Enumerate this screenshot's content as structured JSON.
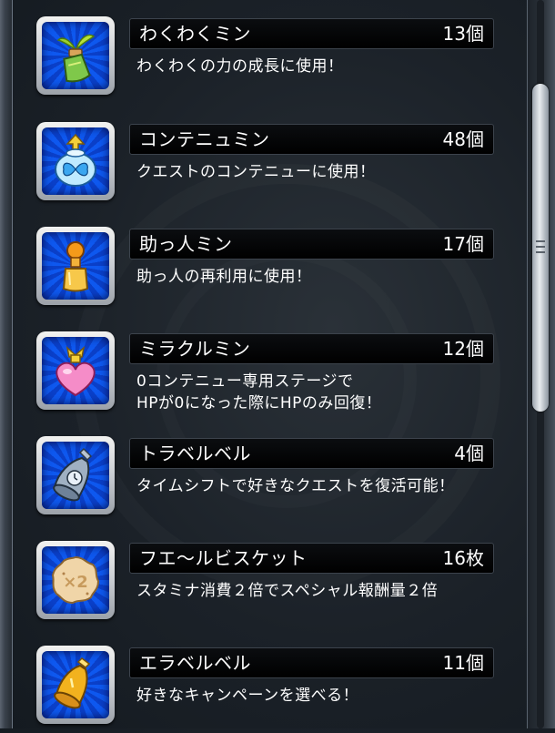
{
  "items": [
    {
      "name": "わくわくミン",
      "count": "13個",
      "description": "わくわくの力の成長に使用！",
      "icon": "sprout-bottle-icon"
    },
    {
      "name": "コンテニュミン",
      "count": "48個",
      "description": "クエストのコンテニューに使用！",
      "icon": "butterfly-potion-icon"
    },
    {
      "name": "助っ人ミン",
      "count": "17個",
      "description": "助っ人の再利用に使用！",
      "icon": "orange-pawn-icon"
    },
    {
      "name": "ミラクルミン",
      "count": "12個",
      "description": "0コンテニュー専用ステージで\nHPが0になった際にHPのみ回復！",
      "icon": "pink-heart-potion-icon"
    },
    {
      "name": "トラベルベル",
      "count": "4個",
      "description": "タイムシフトで好きなクエストを復活可能！",
      "icon": "clock-bell-icon"
    },
    {
      "name": "フエ〜ルビスケット",
      "count": "16枚",
      "description": "スタミナ消費２倍でスペシャル報酬量２倍",
      "icon": "x2-biscuit-icon"
    },
    {
      "name": "エラベルベル",
      "count": "11個",
      "description": "好きなキャンペーンを選べる！",
      "icon": "gold-bell-icon"
    }
  ]
}
